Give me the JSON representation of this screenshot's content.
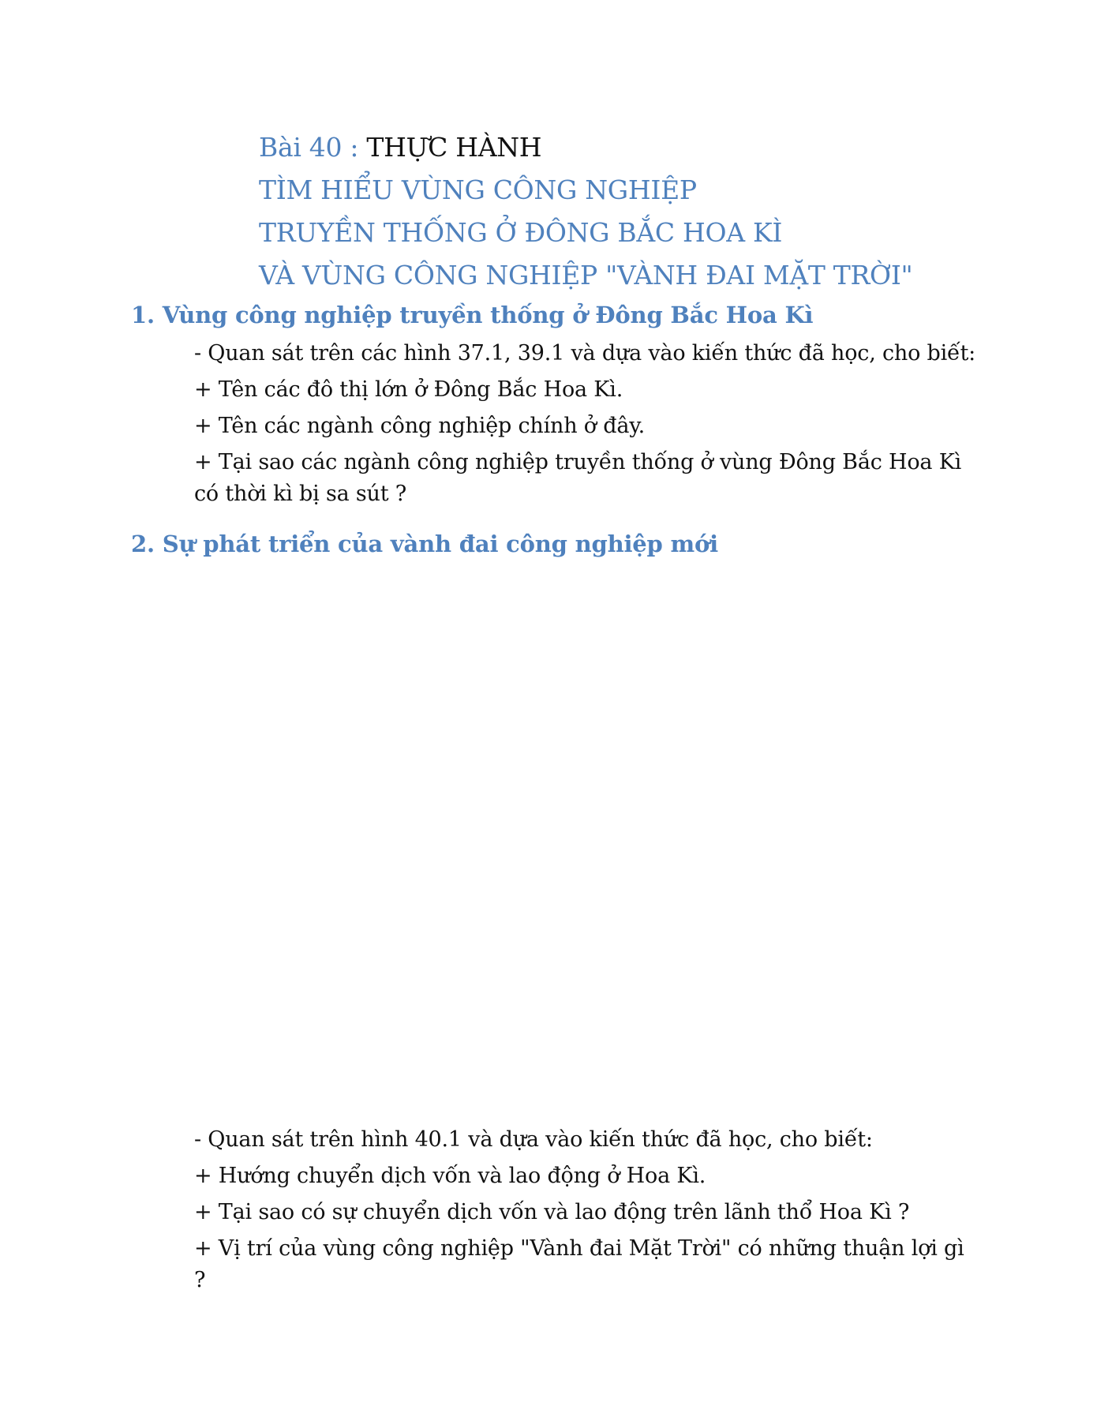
{
  "title": {
    "line1_prefix": "Bài 40 :",
    "line1_main": "THỰC HÀNH",
    "line2": "TÌM HIỂU VÙNG CÔNG NGHIỆP",
    "line3": "TRUYỀN THỐNG Ở ĐÔNG BẮC HOA KÌ",
    "line4": "VÀ VÙNG CÔNG NGHIỆP \"VÀNH ĐAI MẶT TRỜI\""
  },
  "section1": {
    "heading": "1. Vùng công nghiệp truyền thống ở Đông Bắc Hoa Kì",
    "items": [
      "- Quan sát trên các hình 37.1, 39.1 và dựa vào kiến thức đã học, cho biết:",
      "+ Tên các đô thị lớn ở Đông Bắc Hoa Kì.",
      "+ Tên các ngành công nghiệp chính ở đây.",
      "+ Tại sao các ngành công nghiệp truyền thống ở vùng Đông Bắc Hoa Kì có thời kì bị sa sút ?"
    ]
  },
  "section2": {
    "heading": "2. Sự phát triển của vành đai công nghiệp mới",
    "items": [
      "- Quan sát trên hình 40.1 và dựa vào kiến thức đã học, cho biết:",
      "+ Hướng chuyển dịch vốn và lao động ở Hoa Kì.",
      "+ Tại sao có sự chuyển dịch vốn và lao động trên lãnh thổ Hoa Kì ?",
      "+ Vị trí của vùng công nghiệp \"Vành đai Mặt Trời\" có những thuận lợi gì ?"
    ]
  }
}
